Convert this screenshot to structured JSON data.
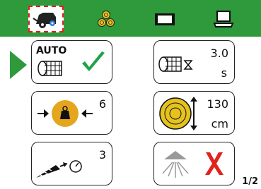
{
  "colors": {
    "accent": "#2e9a3c",
    "check": "#20a24a",
    "cross": "#e0231b",
    "weight": "#e6a51e"
  },
  "tabs": [
    {
      "icon": "baler-icon",
      "active": true
    },
    {
      "icon": "bales-icon",
      "active": false
    },
    {
      "icon": "film-icon",
      "active": false
    },
    {
      "icon": "terminal-icon",
      "active": false
    }
  ],
  "tiles": {
    "auto": {
      "label": "AUTO",
      "status": "enabled"
    },
    "film_time": {
      "value": "3.0",
      "unit": "s"
    },
    "density": {
      "value": "6"
    },
    "diameter": {
      "value": "130",
      "unit": "cm"
    },
    "knife": {
      "value": "3"
    },
    "spray": {
      "status": "disabled"
    }
  },
  "page_indicator": "1/2"
}
